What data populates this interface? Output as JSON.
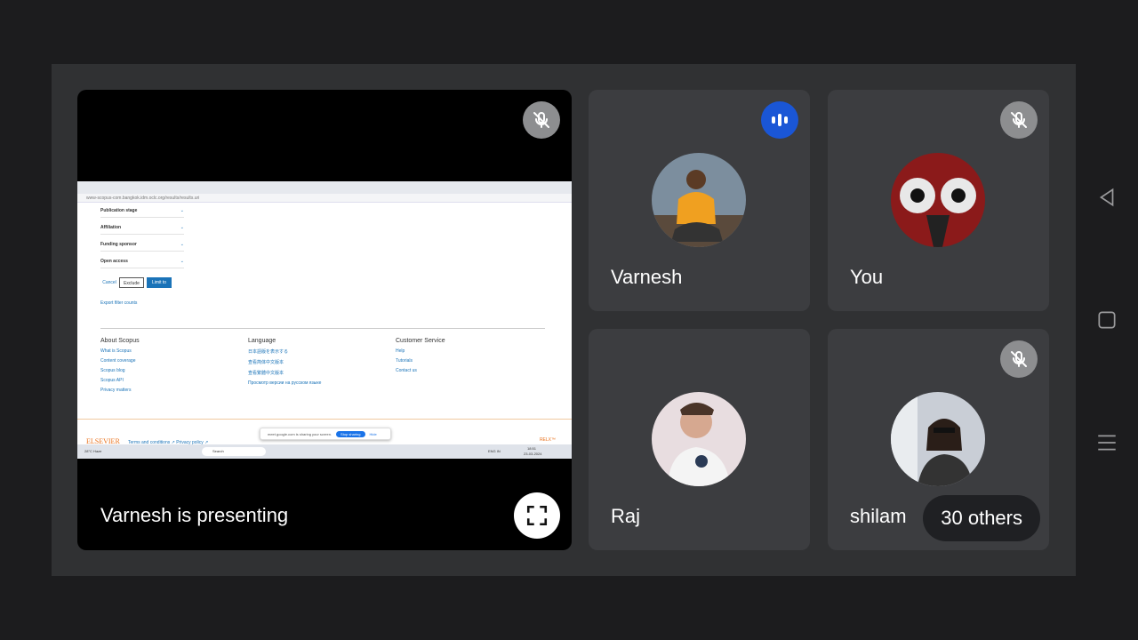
{
  "presenter": {
    "label": "Varnesh is presenting",
    "shared_screen": {
      "url": "www-scopus-com.bangkok.idm.oclc.org/results/results.uri",
      "filters": [
        "Publication stage",
        "Affiliation",
        "Funding sponsor",
        "Open access"
      ],
      "buttons": {
        "cancel": "Cancel",
        "exclude": "Exclude",
        "limit": "Limit to"
      },
      "export_link": "Export filter counts",
      "footer": {
        "about": {
          "title": "About Scopus",
          "links": [
            "What is Scopus",
            "Content coverage",
            "Scopus blog",
            "Scopus API",
            "Privacy matters"
          ]
        },
        "language": {
          "title": "Language",
          "links": [
            "日本語版を表示する",
            "查看简体中文版本",
            "查看繁體中文版本",
            "Просмотр версии на русском языке"
          ]
        },
        "service": {
          "title": "Customer Service",
          "links": [
            "Help",
            "Tutorials",
            "Contact us"
          ]
        }
      },
      "share_bar": {
        "text": "meet.google.com is sharing your screen.",
        "stop": "Stop sharing",
        "hide": "Hide"
      },
      "elsevier": "ELSEVIER",
      "elsevier_links": "Terms and conditions ↗   Privacy policy ↗",
      "relx": "RELX™",
      "taskbar": {
        "weather": "28°C Haze",
        "search": "Search",
        "lang": "ENG IN",
        "time": "18:51",
        "date": "23-03-2024"
      }
    }
  },
  "participants": [
    {
      "name": "Varnesh",
      "status": "speaking"
    },
    {
      "name": "You",
      "status": "muted"
    },
    {
      "name": "Raj",
      "status": "none"
    },
    {
      "name": "shilam",
      "status": "muted"
    }
  ],
  "others_badge": "30 others",
  "colors": {
    "stage": "#303133",
    "tile": "#3c3d40",
    "speaking": "#1a56d6",
    "mic_off": "#8d8e90"
  }
}
